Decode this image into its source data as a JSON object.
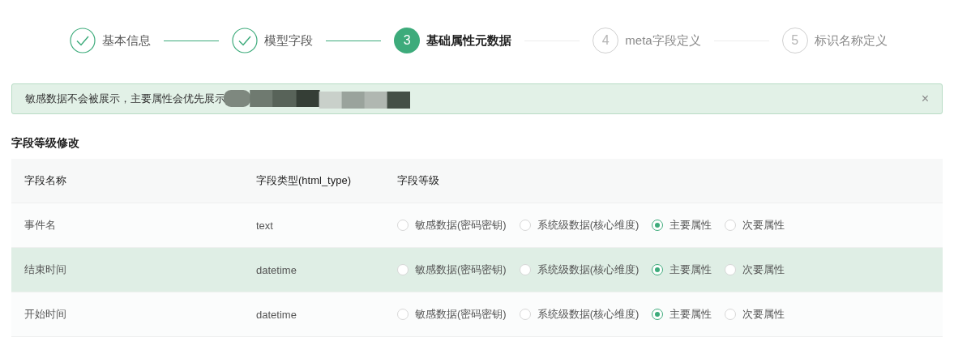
{
  "steps": [
    {
      "label": "基本信息",
      "done": true,
      "current": false
    },
    {
      "label": "模型字段",
      "done": true,
      "current": false
    },
    {
      "number": "3",
      "label": "基础属性元数据",
      "done": false,
      "current": true
    },
    {
      "number": "4",
      "label": "meta字段定义",
      "done": false,
      "current": false
    },
    {
      "number": "5",
      "label": "标识名称定义",
      "done": false,
      "current": false
    }
  ],
  "alert": {
    "text": "敏感数据不会被展示，主要属性会优先展示",
    "close": "×"
  },
  "section_title": "字段等级修改",
  "table": {
    "columns": [
      "字段名称",
      "字段类型(html_type)",
      "字段等级"
    ],
    "rows": [
      {
        "name": "事件名",
        "type": "text",
        "highlighted": false,
        "options": [
          {
            "label": "敏感数据(密码密钥)",
            "selected": false
          },
          {
            "label": "系统级数据(核心维度)",
            "selected": false
          },
          {
            "label": "主要属性",
            "selected": true
          },
          {
            "label": "次要属性",
            "selected": false
          }
        ]
      },
      {
        "name": "结束时间",
        "type": "datetime",
        "highlighted": true,
        "options": [
          {
            "label": "敏感数据(密码密钥)",
            "selected": false
          },
          {
            "label": "系统级数据(核心维度)",
            "selected": false
          },
          {
            "label": "主要属性",
            "selected": true
          },
          {
            "label": "次要属性",
            "selected": false
          }
        ]
      },
      {
        "name": "开始时间",
        "type": "datetime",
        "highlighted": false,
        "options": [
          {
            "label": "敏感数据(密码密钥)",
            "selected": false
          },
          {
            "label": "系统级数据(核心维度)",
            "selected": false
          },
          {
            "label": "主要属性",
            "selected": true
          },
          {
            "label": "次要属性",
            "selected": false
          }
        ]
      }
    ]
  }
}
